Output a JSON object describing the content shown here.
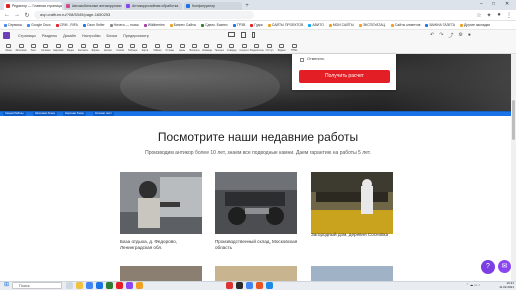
{
  "browser": {
    "tabs": [
      {
        "title": "Редактор — Главная страница",
        "color": "#e31e24",
        "active": true
      },
      {
        "title": "Автомобильные антикоррозии",
        "color": "#d34a8a",
        "active": false
      },
      {
        "title": "Антикоррозийная обработка",
        "color": "#8a46f0",
        "active": false
      },
      {
        "title": "Конфигуратор",
        "color": "#1b73e8",
        "active": false
      }
    ],
    "url": "avp.craftum.ru/?08/5349/page-1650253",
    "bookmarks": [
      {
        "label": "Сервисы",
        "color": "#4285f4"
      },
      {
        "label": "Google Docs",
        "color": "#4285f4"
      },
      {
        "label": "CRM - RIFA",
        "color": "#e31e24"
      },
      {
        "label": "Ozon Seller",
        "color": "#1b73e8"
      },
      {
        "label": "Ничего — поиск",
        "color": "#888888"
      },
      {
        "label": "Wildberries",
        "color": "#a13fa8"
      },
      {
        "label": "Бизнес Сайты",
        "color": "#f0a020"
      },
      {
        "label": "Сделк. Бизнес",
        "color": "#2e7d32"
      },
      {
        "label": "ТРЗВ",
        "color": "#1b73e8"
      },
      {
        "label": "Гудок",
        "color": "#e31e24"
      },
      {
        "label": "САЙТЫ ПРОЕКТОВ",
        "color": "#f0a020"
      },
      {
        "label": "АВИТО",
        "color": "#00aaff"
      },
      {
        "label": "МОИ САЙТЫ",
        "color": "#f0a020"
      },
      {
        "label": "ЭКСПЛУАТАЦ.",
        "color": "#f0a020"
      },
      {
        "label": "Сайты клиентов",
        "color": "#f0a020"
      },
      {
        "label": "ВАЖНА ГАЗЕТА",
        "color": "#1b73e8"
      },
      {
        "label": "Другие закладки",
        "color": "#f0a020"
      }
    ]
  },
  "cms": {
    "menu": [
      "Страницы",
      "Разделы",
      "Дизайн",
      "Настройки",
      "Блоки",
      "Предпросмотр"
    ],
    "tools": [
      "Меню",
      "Заголовок",
      "Текст",
      "Колонки",
      "Картинки",
      "Видео",
      "Контакты",
      "Формы",
      "Кнопки",
      "Список",
      "Таблица",
      "Карта",
      "Таймер",
      "Отзывы",
      "Цены",
      "Вопросы",
      "Команда",
      "Галерея",
      "Слайдер",
      "Соцсети",
      "Разделитель",
      "Отступ",
      "Виджет",
      "HTML"
    ]
  },
  "hero": {
    "checkbox_label": "Отменить",
    "submit_label": "Получить расчет"
  },
  "block_tags": [
    "Секция Работы",
    "Заголовок блока",
    "Картинки блока",
    "Колонки текст"
  ],
  "content": {
    "heading": "Посмотрите наши недавние работы",
    "subtext": "Производим антикор более 10 лет, знаем все подводные камни. Даем гарантию на работы 5 лет.",
    "works": [
      {
        "caption": "База отдыха, д. Федорово, Ленинградская обл."
      },
      {
        "caption": "Производственный склад, Московская область"
      },
      {
        "caption": "Загородный дом, деревня Сосновка"
      }
    ]
  },
  "chat": {
    "icon": "chat-icon"
  },
  "taskbar": {
    "search_placeholder": "Поиск",
    "time": "10:21",
    "date": "11.02.2021"
  },
  "colors": {
    "accent": "#e31e24",
    "cms_purple": "#6b3fb5",
    "block_blue": "#1b73e8"
  }
}
